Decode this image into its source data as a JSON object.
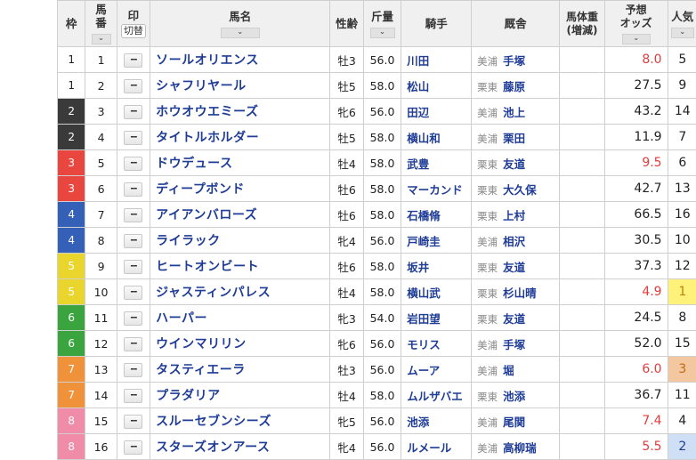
{
  "headers": {
    "waku": "枠",
    "uma_line1": "馬",
    "uma_line2": "番",
    "mark": "印",
    "mark_toggle": "切替",
    "horse": "馬名",
    "sexage": "性齢",
    "weight": "斤量",
    "jockey": "騎手",
    "stable": "厩舎",
    "bodyweight_line1": "馬体重",
    "bodyweight_line2": "(増減)",
    "odds_line1": "予想",
    "odds_line2": "オッズ",
    "popularity": "人気",
    "sort_glyph": "⌄"
  },
  "mark_default": "--",
  "rows": [
    {
      "waku": "1",
      "num": "1",
      "horse": "ソールオリエンス",
      "sexage": "牡3",
      "weight": "56.0",
      "jockey": "川田",
      "region": "美浦",
      "trainer": "手塚",
      "odds": "8.0",
      "pop": "5"
    },
    {
      "waku": "1",
      "num": "2",
      "horse": "シャフリヤール",
      "sexage": "牡5",
      "weight": "58.0",
      "jockey": "松山",
      "region": "栗東",
      "trainer": "藤原",
      "odds": "27.5",
      "pop": "9"
    },
    {
      "waku": "2",
      "num": "3",
      "horse": "ホウオウエミーズ",
      "sexage": "牝6",
      "weight": "56.0",
      "jockey": "田辺",
      "region": "美浦",
      "trainer": "池上",
      "odds": "43.2",
      "pop": "14"
    },
    {
      "waku": "2",
      "num": "4",
      "horse": "タイトルホルダー",
      "sexage": "牡5",
      "weight": "58.0",
      "jockey": "横山和",
      "region": "美浦",
      "trainer": "栗田",
      "odds": "11.9",
      "pop": "7"
    },
    {
      "waku": "3",
      "num": "5",
      "horse": "ドウデュース",
      "sexage": "牡4",
      "weight": "58.0",
      "jockey": "武豊",
      "region": "栗東",
      "trainer": "友道",
      "odds": "9.5",
      "pop": "6"
    },
    {
      "waku": "3",
      "num": "6",
      "horse": "ディープボンド",
      "sexage": "牡6",
      "weight": "58.0",
      "jockey": "マーカンド",
      "region": "栗東",
      "trainer": "大久保",
      "odds": "42.7",
      "pop": "13"
    },
    {
      "waku": "4",
      "num": "7",
      "horse": "アイアンバローズ",
      "sexage": "牡6",
      "weight": "58.0",
      "jockey": "石橋脩",
      "region": "栗東",
      "trainer": "上村",
      "odds": "66.5",
      "pop": "16"
    },
    {
      "waku": "4",
      "num": "8",
      "horse": "ライラック",
      "sexage": "牝4",
      "weight": "56.0",
      "jockey": "戸崎圭",
      "region": "美浦",
      "trainer": "相沢",
      "odds": "30.5",
      "pop": "10"
    },
    {
      "waku": "5",
      "num": "9",
      "horse": "ヒートオンビート",
      "sexage": "牡6",
      "weight": "58.0",
      "jockey": "坂井",
      "region": "栗東",
      "trainer": "友道",
      "odds": "37.3",
      "pop": "12"
    },
    {
      "waku": "5",
      "num": "10",
      "horse": "ジャスティンパレス",
      "sexage": "牡4",
      "weight": "58.0",
      "jockey": "横山武",
      "region": "栗東",
      "trainer": "杉山晴",
      "odds": "4.9",
      "pop": "1"
    },
    {
      "waku": "6",
      "num": "11",
      "horse": "ハーパー",
      "sexage": "牝3",
      "weight": "54.0",
      "jockey": "岩田望",
      "region": "栗東",
      "trainer": "友道",
      "odds": "24.5",
      "pop": "8"
    },
    {
      "waku": "6",
      "num": "12",
      "horse": "ウインマリリン",
      "sexage": "牝6",
      "weight": "56.0",
      "jockey": "モリス",
      "region": "美浦",
      "trainer": "手塚",
      "odds": "52.0",
      "pop": "15"
    },
    {
      "waku": "7",
      "num": "13",
      "horse": "タスティエーラ",
      "sexage": "牡3",
      "weight": "56.0",
      "jockey": "ムーア",
      "region": "美浦",
      "trainer": "堀",
      "odds": "6.0",
      "pop": "3"
    },
    {
      "waku": "7",
      "num": "14",
      "horse": "プラダリア",
      "sexage": "牡4",
      "weight": "58.0",
      "jockey": "ムルザバエ",
      "region": "栗東",
      "trainer": "池添",
      "odds": "36.7",
      "pop": "11"
    },
    {
      "waku": "8",
      "num": "15",
      "horse": "スルーセブンシーズ",
      "sexage": "牝5",
      "weight": "56.0",
      "jockey": "池添",
      "region": "美浦",
      "trainer": "尾関",
      "odds": "7.4",
      "pop": "4"
    },
    {
      "waku": "8",
      "num": "16",
      "horse": "スターズオンアース",
      "sexage": "牝4",
      "weight": "56.0",
      "jockey": "ルメール",
      "region": "美浦",
      "trainer": "高柳瑞",
      "odds": "5.5",
      "pop": "2"
    }
  ]
}
